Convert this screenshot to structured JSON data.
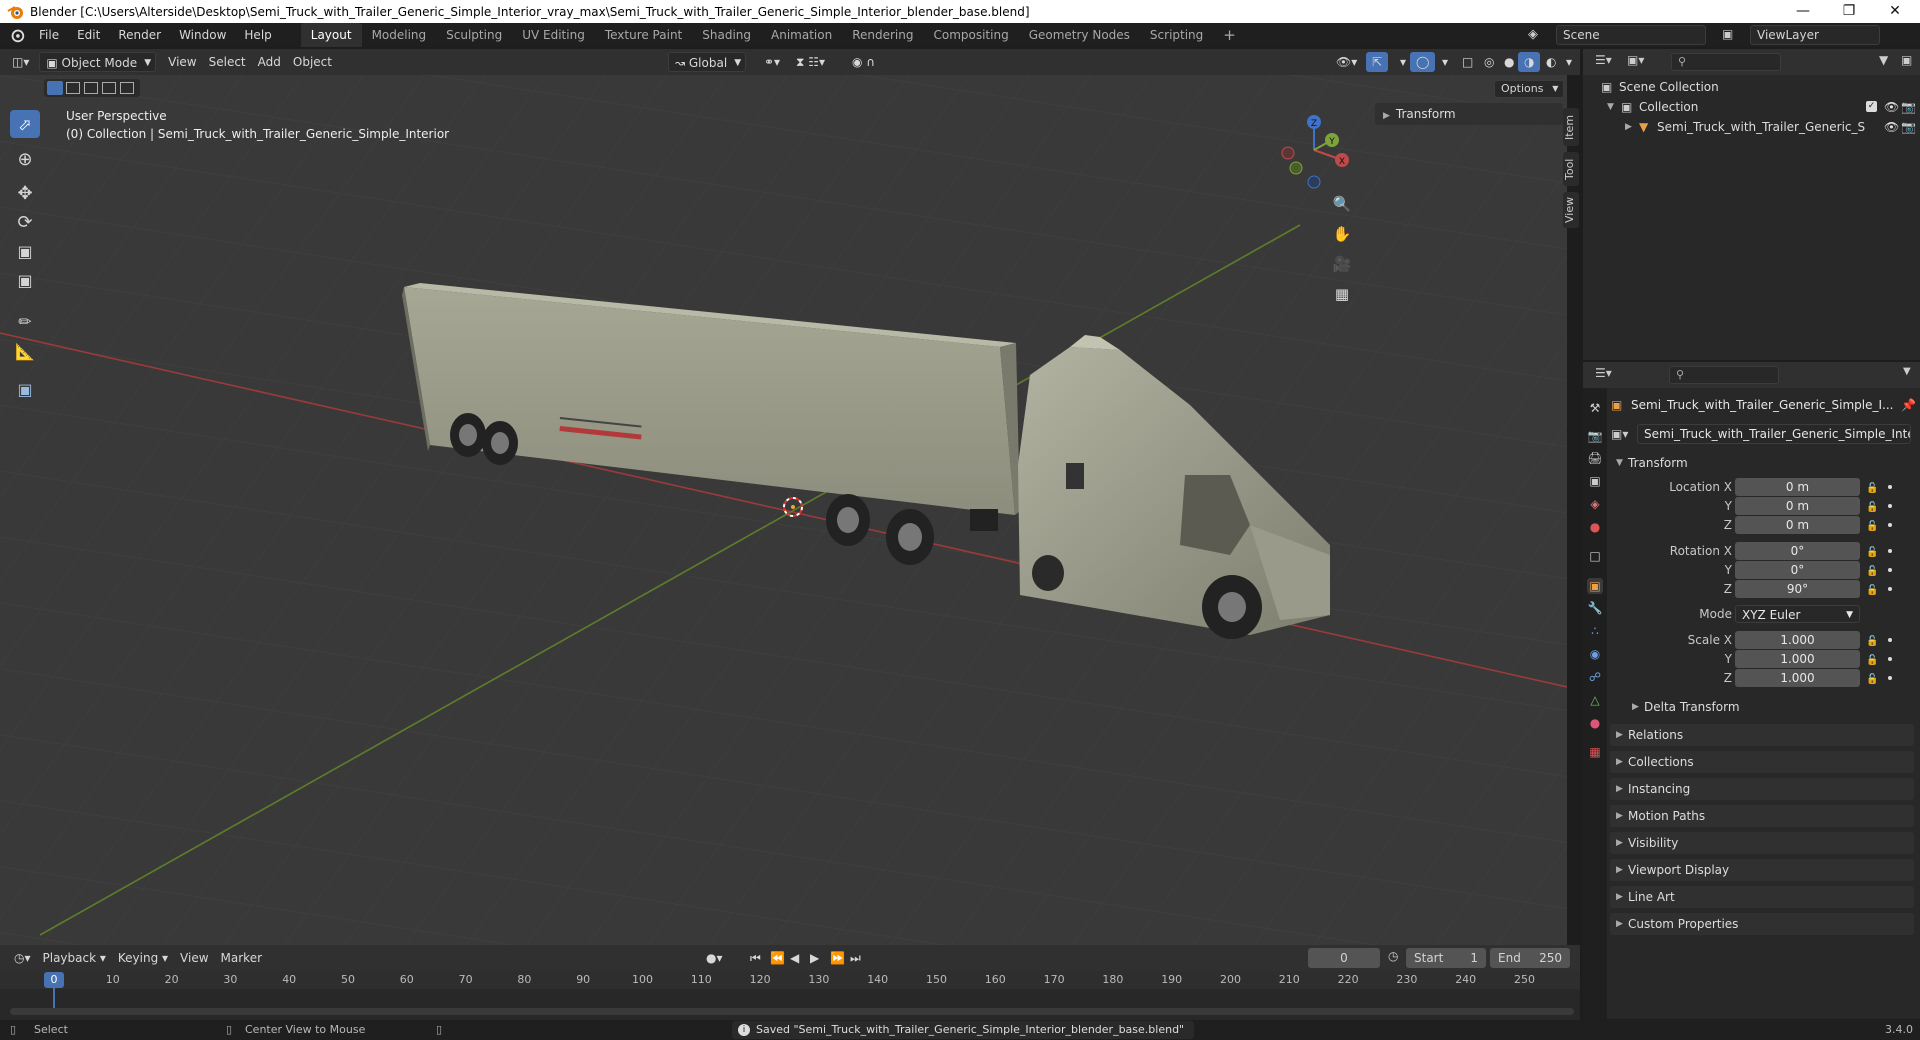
{
  "window": {
    "title": "Blender [C:\\Users\\Alterside\\Desktop\\Semi_Truck_with_Trailer_Generic_Simple_Interior_vray_max\\Semi_Truck_with_Trailer_Generic_Simple_Interior_blender_base.blend]"
  },
  "menu": {
    "items": [
      "File",
      "Edit",
      "Render",
      "Window",
      "Help"
    ],
    "workspaces": [
      "Layout",
      "Modeling",
      "Sculpting",
      "UV Editing",
      "Texture Paint",
      "Shading",
      "Animation",
      "Rendering",
      "Compositing",
      "Geometry Nodes",
      "Scripting"
    ],
    "add_tab": "+",
    "scene_label": "Scene",
    "viewlayer_label": "ViewLayer"
  },
  "viewport_header": {
    "mode": "Object Mode",
    "menus": [
      "View",
      "Select",
      "Add",
      "Object"
    ],
    "orientation": "Global",
    "options": "Options"
  },
  "viewport": {
    "perspective": "User Perspective",
    "collection_info": "(0) Collection | Semi_Truck_with_Trailer_Generic_Simple_Interior",
    "npanel_transform": "Transform",
    "side_tabs": [
      "Item",
      "Tool",
      "View"
    ],
    "gizmo": {
      "x": "X",
      "y": "Y",
      "z": "Z"
    }
  },
  "outliner": {
    "scene_collection": "Scene Collection",
    "collection": "Collection",
    "object": "Semi_Truck_with_Trailer_Generic_S"
  },
  "properties": {
    "object_name": "Semi_Truck_with_Trailer_Generic_Simple_I...",
    "data_name": "Semi_Truck_with_Trailer_Generic_Simple_Inte...",
    "transform_header": "Transform",
    "location_label": "Location X",
    "rotation_label": "Rotation X",
    "scale_label": "Scale X",
    "y_label": "Y",
    "z_label": "Z",
    "location": [
      "0 m",
      "0 m",
      "0 m"
    ],
    "rotation": [
      "0°",
      "0°",
      "90°"
    ],
    "mode_label": "Mode",
    "mode_value": "XYZ Euler",
    "scale": [
      "1.000",
      "1.000",
      "1.000"
    ],
    "delta_transform": "Delta Transform",
    "sections": [
      "Relations",
      "Collections",
      "Instancing",
      "Motion Paths",
      "Visibility",
      "Viewport Display",
      "Line Art",
      "Custom Properties"
    ]
  },
  "timeline": {
    "menus": [
      "Playback",
      "Keying",
      "View",
      "Marker"
    ],
    "current_frame": "0",
    "start_label": "Start",
    "start_value": "1",
    "end_label": "End",
    "end_value": "250",
    "ticks": [
      "0",
      "10",
      "20",
      "30",
      "40",
      "50",
      "60",
      "70",
      "80",
      "90",
      "100",
      "110",
      "120",
      "130",
      "140",
      "150",
      "160",
      "170",
      "180",
      "190",
      "200",
      "210",
      "220",
      "230",
      "240",
      "250"
    ]
  },
  "statusbar": {
    "left": "Select",
    "middle": "Center View to Mouse",
    "message": "Saved \"Semi_Truck_with_Trailer_Generic_Simple_Interior_blender_base.blend\"",
    "version": "3.4.0"
  },
  "colors": {
    "accent": "#4772b3",
    "x_axis": "#c04a4a",
    "y_axis": "#7ea23c",
    "z_axis": "#3f72c8"
  }
}
